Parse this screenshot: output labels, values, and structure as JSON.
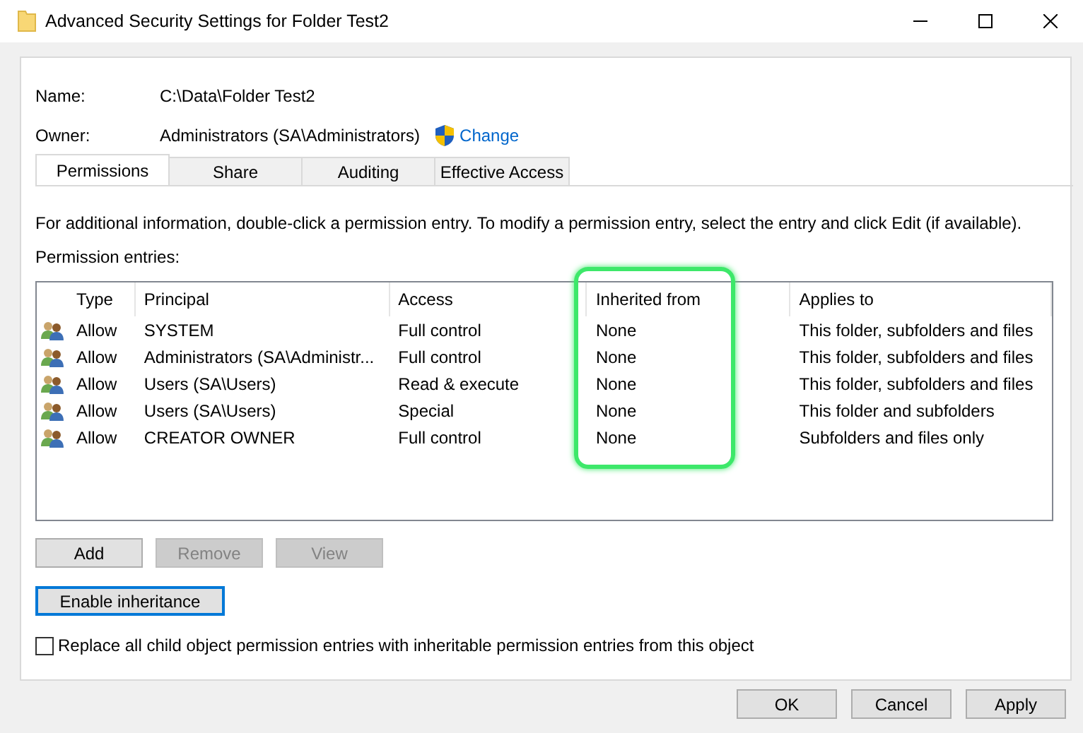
{
  "window": {
    "title": "Advanced Security Settings for Folder Test2"
  },
  "name": {
    "label": "Name:",
    "value": "C:\\Data\\Folder Test2"
  },
  "owner": {
    "label": "Owner:",
    "value": "Administrators (SA\\Administrators)",
    "change_link": "Change"
  },
  "tabs": [
    {
      "label": "Permissions",
      "selected": true
    },
    {
      "label": "Share",
      "selected": false
    },
    {
      "label": "Auditing",
      "selected": false
    },
    {
      "label": "Effective Access",
      "selected": false
    }
  ],
  "info_text": "For additional information, double-click a permission entry. To modify a permission entry, select the entry and click Edit (if available).",
  "entries_label": "Permission entries:",
  "table": {
    "columns": [
      {
        "label": "Type",
        "highlighted": false
      },
      {
        "label": "Principal",
        "highlighted": false
      },
      {
        "label": "Access",
        "highlighted": false
      },
      {
        "label": "Inherited from",
        "highlighted": true
      },
      {
        "label": "Applies to",
        "highlighted": false
      }
    ],
    "rows": [
      [
        "Allow",
        "SYSTEM",
        "Full control",
        "None",
        "This folder, subfolders and files"
      ],
      [
        "Allow",
        "Administrators (SA\\Administr...",
        "Full control",
        "None",
        "This folder, subfolders and files"
      ],
      [
        "Allow",
        "Users (SA\\Users)",
        "Read & execute",
        "None",
        "This folder, subfolders and files"
      ],
      [
        "Allow",
        "Users (SA\\Users)",
        "Special",
        "None",
        "This folder and subfolders"
      ],
      [
        "Allow",
        "CREATOR OWNER",
        "Full control",
        "None",
        "Subfolders and files only"
      ]
    ]
  },
  "entry_buttons": [
    {
      "label": "Add",
      "disabled": false
    },
    {
      "label": "Remove",
      "disabled": true
    },
    {
      "label": "View",
      "disabled": true
    }
  ],
  "inheritance_button": "Enable inheritance",
  "replace_checkbox": {
    "label": "Replace all child object permission entries with inheritable permission entries from this object",
    "checked": false
  },
  "dialog_buttons": [
    "OK",
    "Cancel",
    "Apply"
  ]
}
